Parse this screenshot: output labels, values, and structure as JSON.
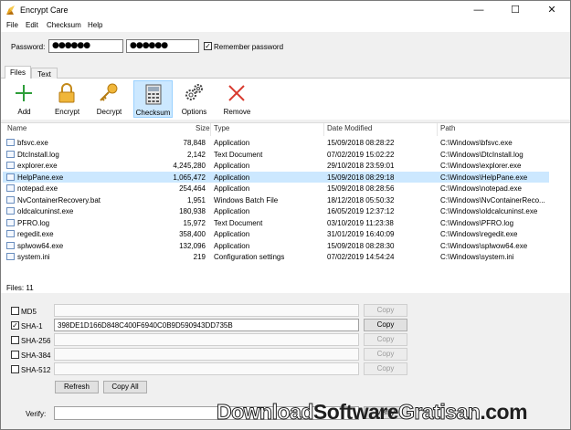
{
  "window": {
    "title": "Encrypt Care",
    "min": "—",
    "max": "☐",
    "close": "✕"
  },
  "menu": [
    "File",
    "Edit",
    "Checksum",
    "Help"
  ],
  "password": {
    "label": "Password:",
    "value1": "●●●●●●",
    "value2": "●●●●●●",
    "remember_label": "Remember password",
    "remember_checked": true
  },
  "tabs": [
    "Files",
    "Text"
  ],
  "toolbar": [
    {
      "label": "Add",
      "icon": "add-icon"
    },
    {
      "label": "Encrypt",
      "icon": "lock-icon"
    },
    {
      "label": "Decrypt",
      "icon": "key-icon"
    },
    {
      "label": "Checksum",
      "icon": "calculator-icon",
      "active": true
    },
    {
      "label": "Options",
      "icon": "gears-icon"
    },
    {
      "label": "Remove",
      "icon": "x-icon"
    }
  ],
  "files": {
    "columns": [
      "Name",
      "Size",
      "Type",
      "Date Modified",
      "Path"
    ],
    "rows": [
      {
        "name": "bfsvc.exe",
        "size": "78,848",
        "type": "Application",
        "date": "15/09/2018 08:28:22",
        "path": "C:\\Windows\\bfsvc.exe"
      },
      {
        "name": "DtcInstall.log",
        "size": "2,142",
        "type": "Text Document",
        "date": "07/02/2019 15:02:22",
        "path": "C:\\Windows\\DtcInstall.log"
      },
      {
        "name": "explorer.exe",
        "size": "4,245,280",
        "type": "Application",
        "date": "29/10/2018 23:59:01",
        "path": "C:\\Windows\\explorer.exe"
      },
      {
        "name": "HelpPane.exe",
        "size": "1,065,472",
        "type": "Application",
        "date": "15/09/2018 08:29:18",
        "path": "C:\\Windows\\HelpPane.exe"
      },
      {
        "name": "notepad.exe",
        "size": "254,464",
        "type": "Application",
        "date": "15/09/2018 08:28:56",
        "path": "C:\\Windows\\notepad.exe"
      },
      {
        "name": "NvContainerRecovery.bat",
        "size": "1,951",
        "type": "Windows Batch File",
        "date": "18/12/2018 05:50:32",
        "path": "C:\\Windows\\NvContainerReco..."
      },
      {
        "name": "oldcalcuninst.exe",
        "size": "180,938",
        "type": "Application",
        "date": "16/05/2019 12:37:12",
        "path": "C:\\Windows\\oldcalcuninst.exe"
      },
      {
        "name": "PFRO.log",
        "size": "15,972",
        "type": "Text Document",
        "date": "03/10/2019 11:23:38",
        "path": "C:\\Windows\\PFRO.log"
      },
      {
        "name": "regedit.exe",
        "size": "358,400",
        "type": "Application",
        "date": "31/01/2019 16:40:09",
        "path": "C:\\Windows\\regedit.exe"
      },
      {
        "name": "splwow64.exe",
        "size": "132,096",
        "type": "Application",
        "date": "15/09/2018 08:28:30",
        "path": "C:\\Windows\\splwow64.exe"
      },
      {
        "name": "system.ini",
        "size": "219",
        "type": "Configuration settings",
        "date": "07/02/2019 14:54:24",
        "path": "C:\\Windows\\system.ini"
      }
    ],
    "selected_index": 3,
    "count_label": "Files: 11"
  },
  "hashes": [
    {
      "label": "MD5",
      "checked": false,
      "value": ""
    },
    {
      "label": "SHA-1",
      "checked": true,
      "value": "398DE1D166D848C400F6940C0B9D590943DD735B"
    },
    {
      "label": "SHA-256",
      "checked": false,
      "value": ""
    },
    {
      "label": "SHA-384",
      "checked": false,
      "value": ""
    },
    {
      "label": "SHA-512",
      "checked": false,
      "value": ""
    }
  ],
  "buttons": {
    "copy": "Copy",
    "refresh": "Refresh",
    "copy_all": "Copy All",
    "verify": "Verify"
  },
  "verify": {
    "label": "Verify:",
    "value": ""
  },
  "watermark": {
    "part1": "Download",
    "part2": "Software",
    "part3": "Gratisan",
    "part4": ".com"
  }
}
